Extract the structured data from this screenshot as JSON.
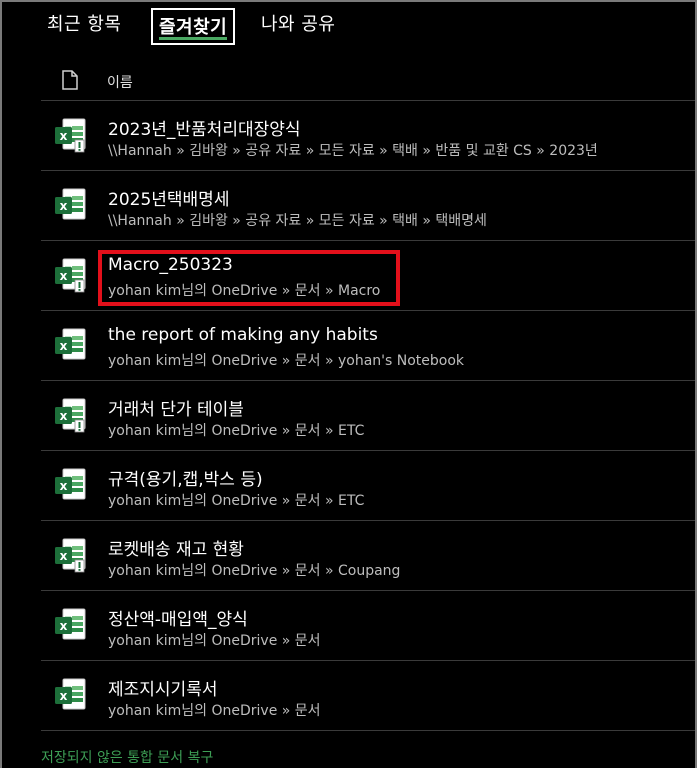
{
  "tabs": [
    {
      "label": "최근 항목"
    },
    {
      "label": "즐겨찾기",
      "selected": true
    },
    {
      "label": "나와 공유"
    }
  ],
  "accent_color": "#4aa862",
  "highlight_color": "#e3101b",
  "header": {
    "name_column": "이름",
    "icon": "document-icon"
  },
  "files": [
    {
      "name": "2023년_반품처리대장양식",
      "path": "\\\\Hannah » 김바왕 » 공유 자료 » 모든 자료 » 택배 » 반품 및 교환 CS » 2023년",
      "icon": "excel-macro-icon"
    },
    {
      "name": "2025년택배명세",
      "path": "\\\\Hannah » 김바왕 » 공유 자료 » 모든 자료 » 택배 » 택배명세",
      "icon": "excel-icon"
    },
    {
      "name": "Macro_250323",
      "path": "yohan kim님의 OneDrive » 문서 » Macro",
      "icon": "excel-macro-icon",
      "highlighted": true
    },
    {
      "name": "the report of making any habits",
      "path": "yohan kim님의 OneDrive » 문서 » yohan's Notebook",
      "icon": "excel-icon"
    },
    {
      "name": "거래처 단가 테이블",
      "path": "yohan kim님의 OneDrive » 문서 » ETC",
      "icon": "excel-macro-icon"
    },
    {
      "name": "규격(용기,캡,박스 등)",
      "path": "yohan kim님의 OneDrive » 문서 » ETC",
      "icon": "excel-icon"
    },
    {
      "name": "로켓배송 재고 현황",
      "path": "yohan kim님의 OneDrive » 문서 » Coupang",
      "icon": "excel-macro-icon"
    },
    {
      "name": "정산액-매입액_양식",
      "path": "yohan kim님의 OneDrive » 문서",
      "icon": "excel-icon"
    },
    {
      "name": "제조지시기록서",
      "path": "yohan kim님의 OneDrive » 문서",
      "icon": "excel-icon"
    }
  ],
  "footer": {
    "recover_link": "저장되지 않은 통합 문서 복구"
  }
}
